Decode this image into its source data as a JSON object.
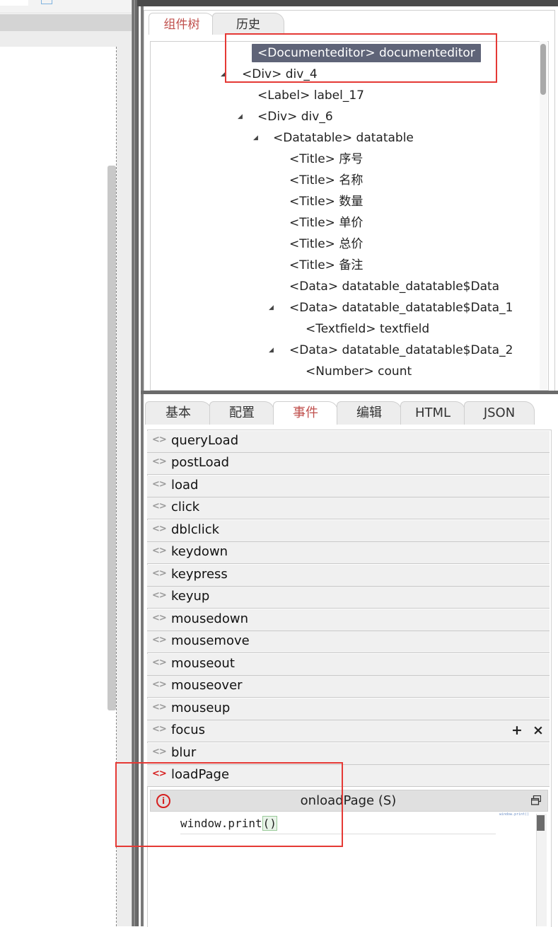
{
  "tree_panel": {
    "tabs": [
      {
        "label": "组件树",
        "active": true
      },
      {
        "label": "历史",
        "active": false
      }
    ],
    "nodes": [
      {
        "label": "<Documenteditor> documenteditor",
        "selected": true,
        "expanded": null
      },
      {
        "label": "<Div> div_4",
        "selected": false,
        "expanded": true
      },
      {
        "label": "<Label> label_17",
        "selected": false,
        "expanded": null
      },
      {
        "label": "<Div> div_6",
        "selected": false,
        "expanded": true
      },
      {
        "label": "<Datatable> datatable",
        "selected": false,
        "expanded": true
      },
      {
        "label": "<Title> 序号",
        "selected": false,
        "expanded": null
      },
      {
        "label": "<Title> 名称",
        "selected": false,
        "expanded": null
      },
      {
        "label": "<Title> 数量",
        "selected": false,
        "expanded": null
      },
      {
        "label": "<Title> 单价",
        "selected": false,
        "expanded": null
      },
      {
        "label": "<Title> 总价",
        "selected": false,
        "expanded": null
      },
      {
        "label": "<Title> 备注",
        "selected": false,
        "expanded": null
      },
      {
        "label": "<Data> datatable_datatable$Data",
        "selected": false,
        "expanded": null
      },
      {
        "label": "<Data> datatable_datatable$Data_1",
        "selected": false,
        "expanded": true
      },
      {
        "label": "<Textfield> textfield",
        "selected": false,
        "expanded": null
      },
      {
        "label": "<Data> datatable_datatable$Data_2",
        "selected": false,
        "expanded": true
      },
      {
        "label": "<Number> count",
        "selected": false,
        "expanded": null
      }
    ]
  },
  "props_panel": {
    "tabs": [
      {
        "label": "基本",
        "active": false
      },
      {
        "label": "配置",
        "active": false
      },
      {
        "label": "事件",
        "active": true
      },
      {
        "label": "编辑",
        "active": false
      },
      {
        "label": "HTML",
        "active": false
      },
      {
        "label": "JSON",
        "active": false
      }
    ],
    "events": [
      {
        "name": "queryLoad",
        "has_handler": false
      },
      {
        "name": "postLoad",
        "has_handler": false
      },
      {
        "name": "load",
        "has_handler": false
      },
      {
        "name": "click",
        "has_handler": false
      },
      {
        "name": "dblclick",
        "has_handler": false
      },
      {
        "name": "keydown",
        "has_handler": false
      },
      {
        "name": "keypress",
        "has_handler": false
      },
      {
        "name": "keyup",
        "has_handler": false
      },
      {
        "name": "mousedown",
        "has_handler": false
      },
      {
        "name": "mousemove",
        "has_handler": false
      },
      {
        "name": "mouseout",
        "has_handler": false
      },
      {
        "name": "mouseover",
        "has_handler": false
      },
      {
        "name": "mouseup",
        "has_handler": false
      },
      {
        "name": "focus",
        "has_handler": false
      },
      {
        "name": "blur",
        "has_handler": false
      },
      {
        "name": "loadPage",
        "has_handler": true
      }
    ],
    "focus_actions": {
      "add": "+",
      "remove": "×"
    },
    "editor": {
      "title": "onloadPage (S)",
      "code_prefix": "window.print",
      "code_parens": "()",
      "minimap_text": "window.print()"
    }
  },
  "colors": {
    "selected_node_bg": "#5f6478",
    "active_tab_text": "#c0504d",
    "active_event_icon": "#d62020",
    "annotation_red": "#e53935"
  },
  "icons": {
    "tree_caret": "expanded-triangle",
    "event_icon": "code-brackets-icon",
    "editor_info": "info-circle-icon",
    "editor_restore": "window-restore-icon"
  }
}
